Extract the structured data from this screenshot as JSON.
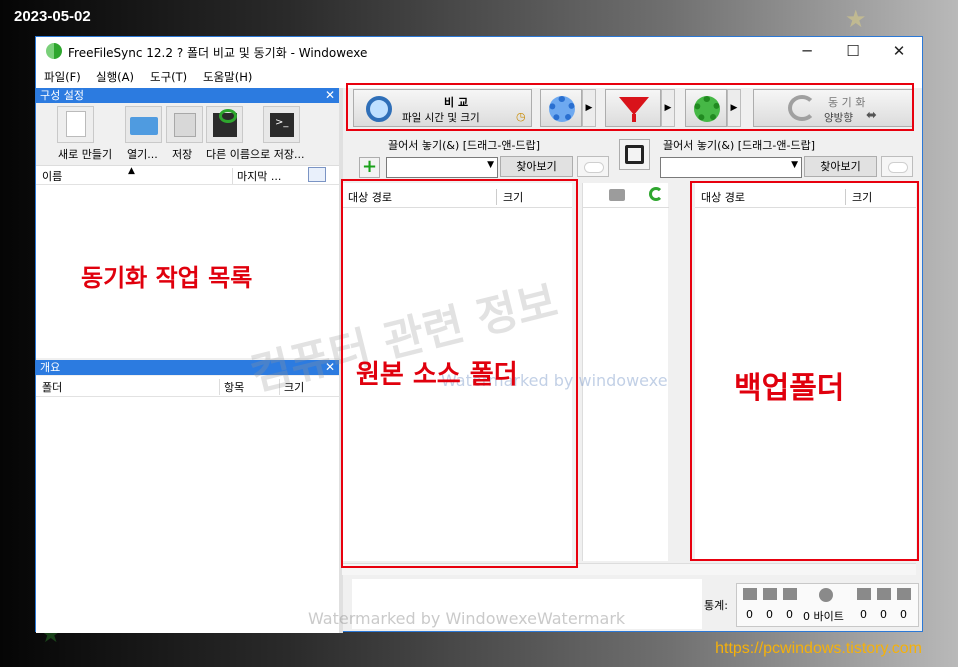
{
  "overlay": {
    "date": "2023-05-02",
    "url": "https://pcwindows.tistory.com",
    "watermark_big": "컴퓨터 관련 정보",
    "watermark_small": "Watermarked by windowexe",
    "watermark_bottom": "Watermarked by WindowexeWatermark"
  },
  "window": {
    "title": "FreeFileSync 12.2 ? 폴더 비교 및 동기화   - Windowexe",
    "minimize": "─",
    "maximize": "☐",
    "close": "✕"
  },
  "menu": [
    "파일(F)",
    "실행(A)",
    "도구(T)",
    "도움말(H)"
  ],
  "config_panel": {
    "header": "구성 설정",
    "close": "✕",
    "buttons": [
      "새로 만들기",
      "열기...",
      "저장",
      "다른 이름으로 저장..."
    ],
    "col_name": "이름",
    "col_last": "마지막 ..."
  },
  "overview_panel": {
    "header": "개요",
    "close": "✕",
    "cols": [
      "폴더",
      "항목",
      "크기"
    ]
  },
  "toolbar": {
    "compare_title": "비 교",
    "compare_sub": "파일 시간 및 크기",
    "sync_title": "동 기 화",
    "sync_sub": "양방향"
  },
  "left_folder": {
    "drag_label": "끌어서 놓기(&) [드래그-앤-드랍]",
    "browse": "찾아보기",
    "col_path": "대상 경로",
    "col_size": "크기"
  },
  "right_folder": {
    "drag_label": "끌어서 놓기(&) [드래그-앤-드랍]",
    "browse": "찾아보기",
    "col_path": "대상 경로",
    "col_size": "크기"
  },
  "stats": {
    "label": "통계:",
    "values": [
      "0",
      "0",
      "0",
      "0 바이트",
      "0",
      "0",
      "0"
    ]
  },
  "annotations": {
    "job_list": "동기화 작업 목록",
    "source": "원본 소스 폴더",
    "backup": "백업폴더"
  },
  "colors": {
    "annotation_red": "#e0000d",
    "title_blue": "#2c7be0",
    "url_orange": "#f5b10a"
  }
}
